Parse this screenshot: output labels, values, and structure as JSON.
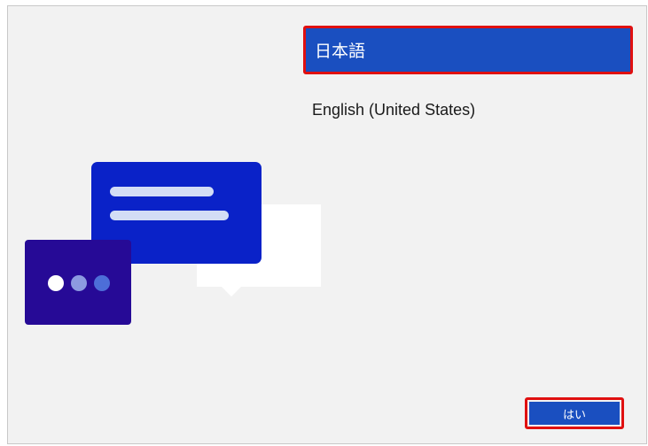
{
  "languages": {
    "items": [
      {
        "label": "日本語",
        "selected": true
      },
      {
        "label": "English (United States)",
        "selected": false
      }
    ]
  },
  "footer": {
    "yes_label": "はい"
  },
  "colors": {
    "selection": "#1a4fc0",
    "highlight_outline": "#e01010",
    "background": "#f2f2f2",
    "illustration_blue": "#0a22c8",
    "illustration_purple": "#260a96"
  },
  "icons": {
    "illustration": "chat-bubbles-illustration"
  }
}
